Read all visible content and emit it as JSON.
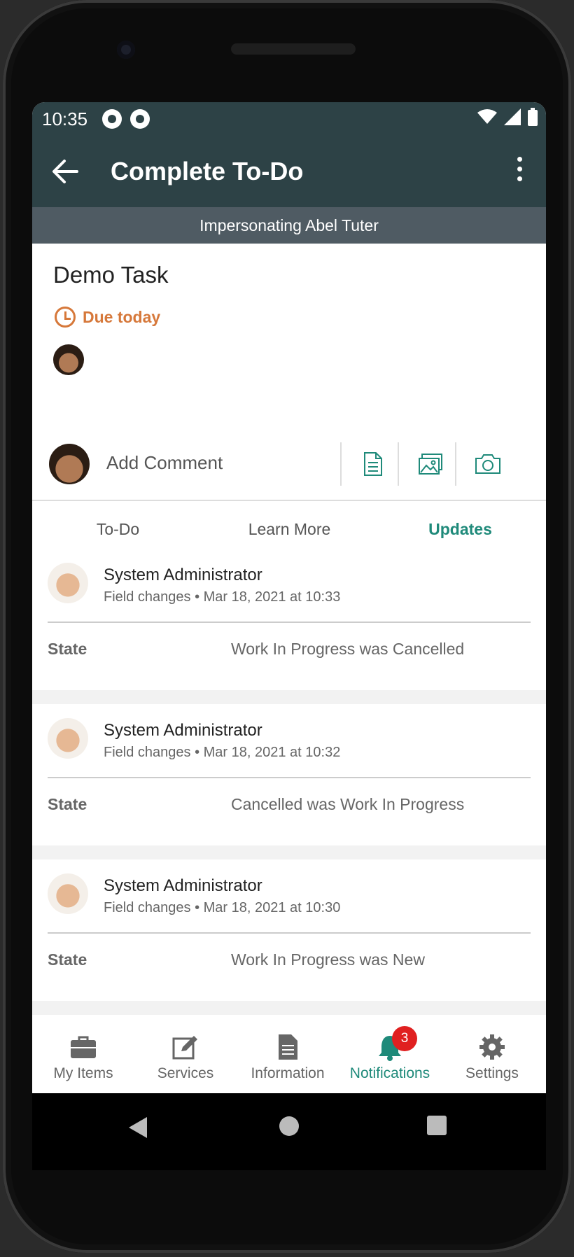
{
  "status_bar": {
    "time": "10:35"
  },
  "appbar": {
    "title": "Complete To-Do"
  },
  "impersonation_banner": "Impersonating Abel Tuter",
  "task": {
    "title": "Demo Task",
    "due": "Due today"
  },
  "tabs": [
    {
      "label": "To-Do",
      "active": false
    },
    {
      "label": "Learn More",
      "active": false
    },
    {
      "label": "Updates",
      "active": true
    }
  ],
  "comment_bar": {
    "placeholder": "Add Comment"
  },
  "updates": [
    {
      "author": "System Administrator",
      "meta": "Field changes • Mar 18, 2021 at 10:33",
      "field": "State",
      "value": "Work In Progress was Cancelled"
    },
    {
      "author": "System Administrator",
      "meta": "Field changes • Mar 18, 2021 at 10:32",
      "field": "State",
      "value": "Cancelled was Work In Progress"
    },
    {
      "author": "System Administrator",
      "meta": "Field changes • Mar 18, 2021 at 10:30",
      "field": "State",
      "value": "Work In Progress was New"
    }
  ],
  "bottom_nav": [
    {
      "label": "My Items",
      "icon": "briefcase-icon"
    },
    {
      "label": "Services",
      "icon": "edit-icon"
    },
    {
      "label": "Information",
      "icon": "document-icon"
    },
    {
      "label": "Notifications",
      "icon": "bell-icon",
      "badge": "3",
      "active": true
    },
    {
      "label": "Settings",
      "icon": "gear-icon"
    }
  ],
  "colors": {
    "appbar": "#2d4246",
    "accent": "#1f8a7a",
    "due": "#d6783a",
    "banner": "#4f5b63",
    "badge": "#e02020"
  }
}
